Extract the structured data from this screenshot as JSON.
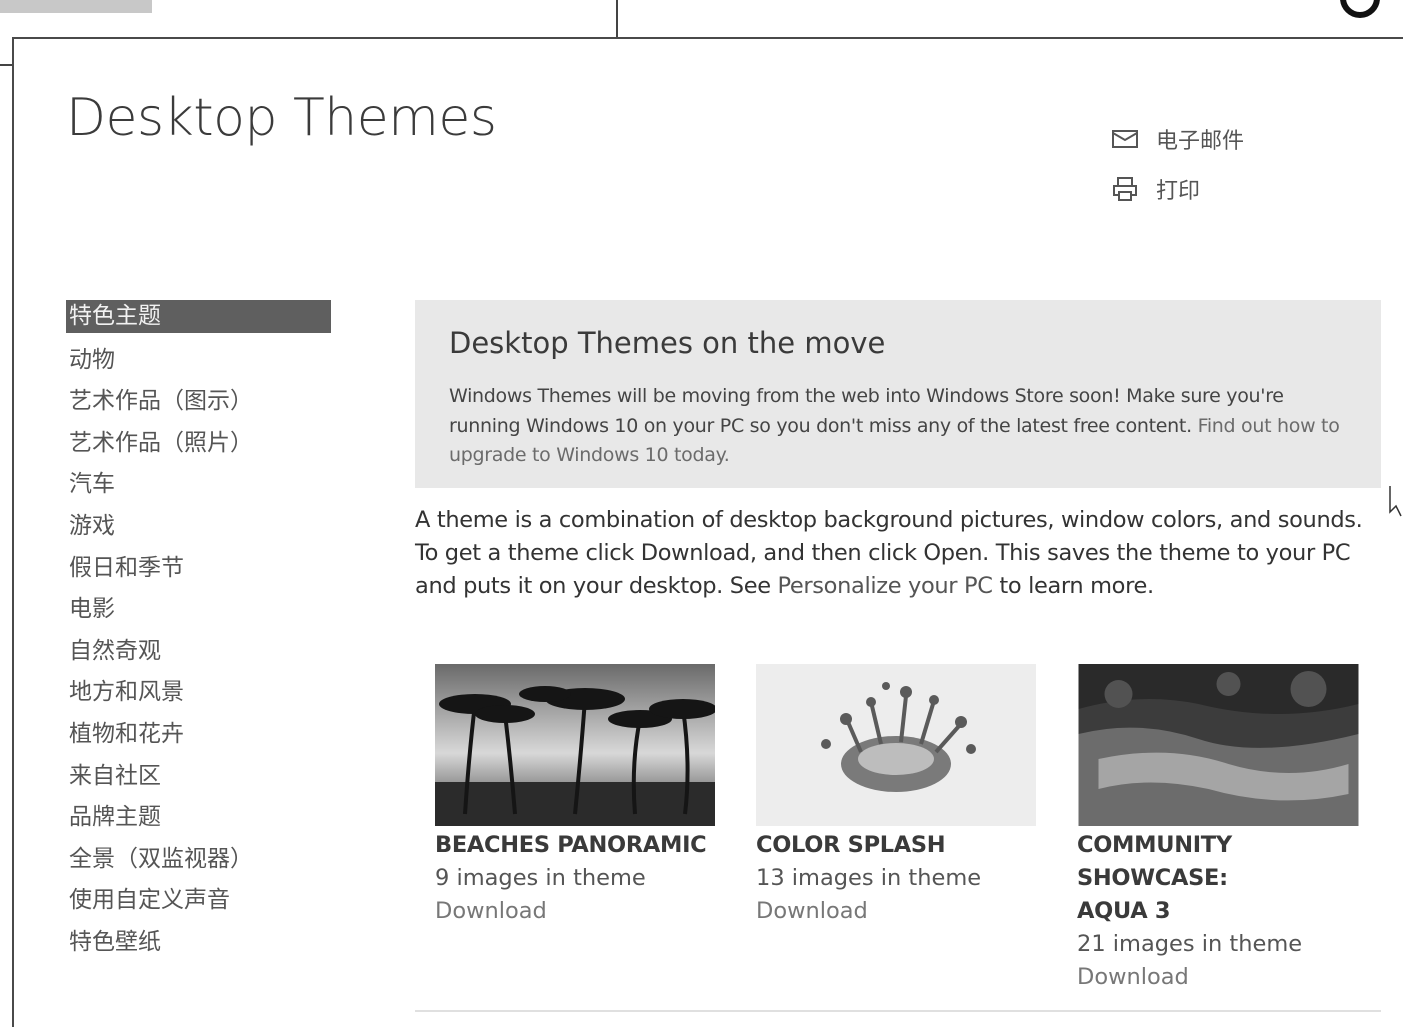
{
  "page": {
    "title": "Desktop Themes"
  },
  "share": {
    "email_label": "电子邮件",
    "email_icon": "envelope-icon",
    "print_label": "打印",
    "print_icon": "printer-icon"
  },
  "sidebar": {
    "items": [
      {
        "label": "特色主题",
        "active": true
      },
      {
        "label": "动物"
      },
      {
        "label": "艺术作品（图示）"
      },
      {
        "label": "艺术作品（照片）"
      },
      {
        "label": "汽车"
      },
      {
        "label": "游戏"
      },
      {
        "label": "假日和季节"
      },
      {
        "label": "电影"
      },
      {
        "label": "自然奇观"
      },
      {
        "label": "地方和风景"
      },
      {
        "label": "植物和花卉"
      },
      {
        "label": "来自社区"
      },
      {
        "label": "品牌主题"
      },
      {
        "label": "全景（双监视器）"
      },
      {
        "label": "使用自定义声音"
      },
      {
        "label": "特色壁纸"
      }
    ]
  },
  "notice": {
    "title": "Desktop Themes on the move",
    "body": "Windows Themes will be moving from the web into Windows Store soon! Make sure you're running Windows 10 on your PC so you don't miss any of the latest free content.",
    "link": "Find out how to upgrade to Windows 10 today."
  },
  "intro": {
    "text_before": "A theme is a combination of desktop background pictures, window colors, and sounds. To get a theme click Download, and then click Open. This saves the theme to your PC and puts it on your desktop. See ",
    "link": "Personalize your PC",
    "text_after": " to learn more."
  },
  "themes": [
    {
      "name": "BEACHES PANORAMIC",
      "count": "9 images in theme",
      "download": "Download"
    },
    {
      "name": "COLOR SPLASH",
      "count": "13 images in theme",
      "download": "Download"
    },
    {
      "name": "COMMUNITY SHOWCASE: AQUA 3",
      "count": "21 images in theme",
      "download": "Download"
    }
  ],
  "colors": {
    "active_bg": "#5f5f5f",
    "notice_bg": "#e8e8e8"
  }
}
